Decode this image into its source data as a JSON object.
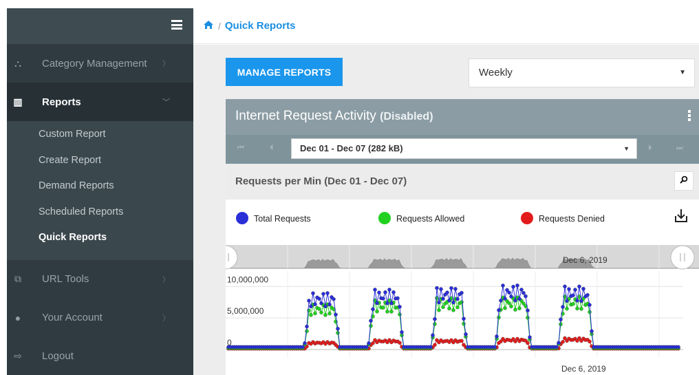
{
  "sidebar": {
    "items": [
      {
        "label": "Category Management",
        "icon": "sitemap-icon",
        "glyph": "⛬"
      },
      {
        "label": "Reports",
        "icon": "bar-chart-icon",
        "glyph": "▥"
      },
      {
        "label": "URL Tools",
        "icon": "url-tools-icon",
        "glyph": "⧉"
      },
      {
        "label": "Your Account",
        "icon": "user-icon",
        "glyph": "●"
      },
      {
        "label": "Logout",
        "icon": "logout-icon",
        "glyph": "⇨"
      }
    ],
    "sub_items": [
      "Custom Report",
      "Create Report",
      "Demand Reports",
      "Scheduled Reports",
      "Quick Reports"
    ]
  },
  "breadcrumb": {
    "home_glyph": "🏠",
    "separator": "/",
    "current": "Quick Reports"
  },
  "manage_button": "MANAGE REPORTS",
  "period_select": {
    "value": "Weekly"
  },
  "panel": {
    "title": "Internet Request Activity",
    "status": "(Disabled)",
    "range_select": "Dec 01 - Dec 07 (282 kB)",
    "chart_title": "Requests per Min (Dec 01 - Dec 07)"
  },
  "chart_data": {
    "type": "line",
    "series": [
      {
        "name": "Total Requests",
        "color": "#2a2fd8"
      },
      {
        "name": "Requests Allowed",
        "color": "#22d11f"
      },
      {
        "name": "Requests Denied",
        "color": "#e21c1c"
      }
    ],
    "y_ticks": [
      "10,000,000",
      "5,000,000",
      "0"
    ],
    "ylim": [
      0,
      12000000
    ],
    "x_label_bottom": "Dec 6, 2019",
    "navigator_label": "Dec 6, 2019",
    "peaks_total": [
      9000000,
      9500000,
      9800000,
      10200000,
      10000000
    ],
    "peaks_allowed": [
      7200000,
      7800000,
      8200000,
      8300000,
      8400000
    ],
    "peaks_denied": [
      1200000,
      1500000,
      1500000,
      1700000,
      1800000
    ]
  },
  "colors": {
    "accent": "#1a96ec",
    "sidebar": "#2f3b41",
    "panel_header": "#8b9ca4"
  }
}
